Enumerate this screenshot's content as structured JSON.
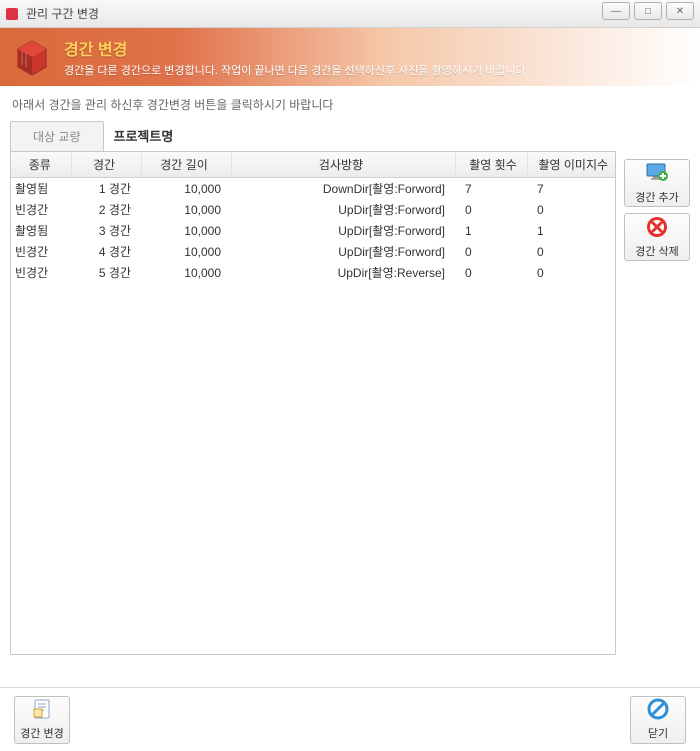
{
  "window": {
    "title": "관리 구간 변경",
    "min": "—",
    "max": "□",
    "close": "✕"
  },
  "header": {
    "title": "경간 변경",
    "subtitle": "경간을 다른 경간으로 변경합니다. 작업이 끝나면 다음 경간을 선택하신후 사진을 촬영하시기 바랍니다"
  },
  "instruction": "아래서 경간을 관리 하신후 경간변경 버튼을 클릭하시기 바랍니다",
  "tab": {
    "label": "대상 교량",
    "project": "프로젝트명"
  },
  "columns": {
    "type": "종류",
    "span": "경간",
    "length": "경간 길이",
    "direction": "검사방향",
    "shots": "촬영 횟수",
    "images": "촬영 이미지수"
  },
  "rows": [
    {
      "type": "촬영됨",
      "span": "1 경간",
      "length": "10,000",
      "direction": "DownDir[촬영:Forword]",
      "shots": "7",
      "images": "7"
    },
    {
      "type": "빈경간",
      "span": "2 경간",
      "length": "10,000",
      "direction": "UpDir[촬영:Forword]",
      "shots": "0",
      "images": "0"
    },
    {
      "type": "촬영됨",
      "span": "3 경간",
      "length": "10,000",
      "direction": "UpDir[촬영:Forword]",
      "shots": "1",
      "images": "1"
    },
    {
      "type": "빈경간",
      "span": "4 경간",
      "length": "10,000",
      "direction": "UpDir[촬영:Forword]",
      "shots": "0",
      "images": "0"
    },
    {
      "type": "빈경간",
      "span": "5 경간",
      "length": "10,000",
      "direction": "UpDir[촬영:Reverse]",
      "shots": "0",
      "images": "0"
    }
  ],
  "buttons": {
    "add": "경간 추가",
    "delete": "경간 삭제",
    "change": "경간 변경",
    "close": "닫기"
  }
}
